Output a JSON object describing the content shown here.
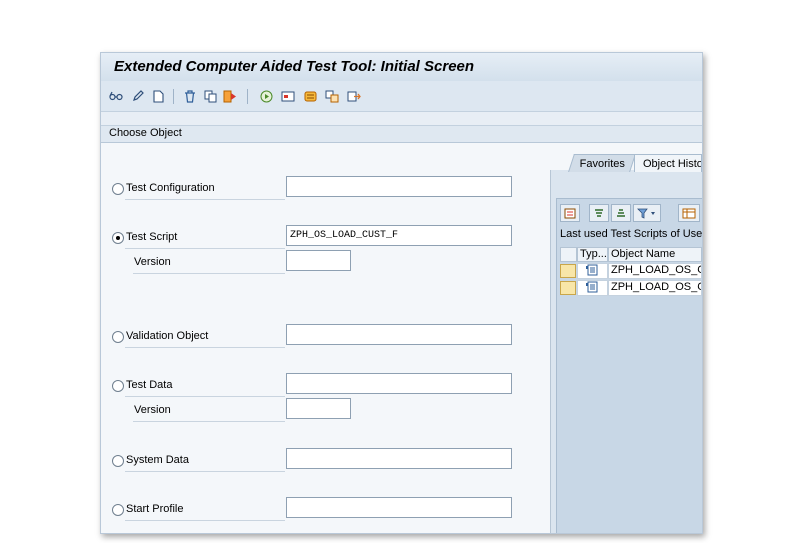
{
  "window": {
    "title": "Extended Computer Aided Test Tool: Initial Screen"
  },
  "toolbar": {
    "icons": [
      "glasses-icon",
      "pencil-icon",
      "new-document-icon",
      "trash-icon",
      "copy-icon",
      "rename-icon",
      "execute-icon",
      "dashboard-icon",
      "script-icon",
      "compare-icon",
      "export-icon"
    ]
  },
  "group": {
    "title": "Choose Object"
  },
  "form": {
    "test_configuration": {
      "label": "Test Configuration",
      "value": "",
      "selected": false
    },
    "test_script": {
      "label": "Test Script",
      "value": "ZPH_OS_LOAD_CUST_F",
      "selected": true,
      "version_label": "Version",
      "version_value": ""
    },
    "validation_object": {
      "label": "Validation Object",
      "value": "",
      "selected": false
    },
    "test_data": {
      "label": "Test Data",
      "value": "",
      "selected": false,
      "version_label": "Version",
      "version_value": ""
    },
    "system_data": {
      "label": "System Data",
      "value": "",
      "selected": false
    },
    "start_profile": {
      "label": "Start Profile",
      "value": "",
      "selected": false
    }
  },
  "history": {
    "tabs": [
      "Favorites",
      "Object History"
    ],
    "active_tab": "Object History",
    "grid_title": "Last used Test Scripts of User",
    "columns": [
      "Type",
      "Object Name"
    ],
    "column_labels_shown": [
      "Typ...",
      "Object Name"
    ],
    "rows": [
      {
        "object_name": "ZPH_LOAD_OS_CUST"
      },
      {
        "object_name": "ZPH_LOAD_OS_CUST"
      }
    ]
  },
  "colors": {
    "selection_cell": "#f8e6a8",
    "frame": "#dfe8f2"
  }
}
